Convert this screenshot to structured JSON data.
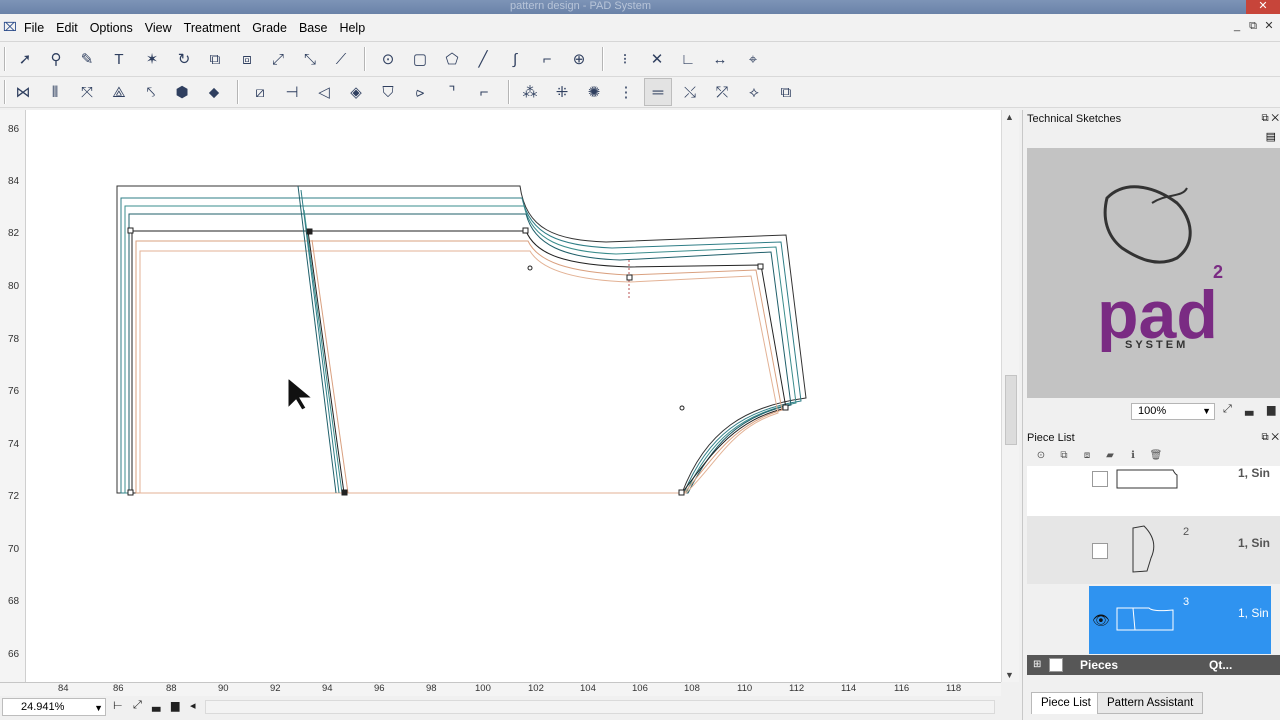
{
  "window": {
    "title": "pattern design - PAD System",
    "close_label": "✕"
  },
  "menu": [
    "File",
    "Edit",
    "Options",
    "View",
    "Treatment",
    "Grade",
    "Base",
    "Help"
  ],
  "window_controls": [
    "_",
    "⧉",
    "✕"
  ],
  "toolbar1_icons": [
    "select-arrow-icon",
    "zoom-icon",
    "measure-ruler-icon",
    "text-tool-icon",
    "point-tool-icon",
    "rotate-icon",
    "copy-piece-icon",
    "move-piece-icon",
    "scale-icon",
    "split-icon",
    "mirror-icon",
    "circle-tool-icon",
    "rectangle-tool-icon",
    "polygon-tool-icon",
    "line-tool-icon",
    "curve-tool-icon",
    "notch-tool-icon",
    "globe-tool-icon",
    "point-insert-icon",
    "point-delete-icon",
    "angle-tool-icon",
    "move-point-icon",
    "trace-icon"
  ],
  "toolbar2_icons": [
    "grade-rule-icon",
    "grade-copy-icon",
    "grade-scale-icon",
    "seam-icon",
    "dart-icon",
    "pleat-icon",
    "fold-icon",
    "box-tool-icon",
    "stretch-icon",
    "arrow-left-icon",
    "diamond-tool-icon",
    "shield-tool-icon",
    "corner-icon",
    "arc-tool-icon",
    "corner-curve-icon",
    "nest-icon",
    "piece-join-icon",
    "match-icon",
    "grade-nest-icon",
    "parallel-icon",
    "measure-icon",
    "grade-alt-icon",
    "gradient-icon",
    "layer-icon"
  ],
  "vruler_labels": [
    "86",
    "84",
    "82",
    "80",
    "78",
    "76",
    "74",
    "72",
    "70",
    "68",
    "66"
  ],
  "hruler_labels": [
    "84",
    "86",
    "88",
    "90",
    "92",
    "94",
    "96",
    "98",
    "100",
    "102",
    "104",
    "106",
    "108",
    "110",
    "112",
    "114",
    "116",
    "118"
  ],
  "status": {
    "zoom": "24.941%"
  },
  "panels": {
    "sketches": {
      "title": "Technical Sketches",
      "zoom": "100%",
      "logo_text": "pad",
      "logo_sup": "2",
      "logo_sub": "SYSTEM"
    },
    "piece_list": {
      "title": "Piece List",
      "rows": [
        {
          "num": "",
          "size": "1, Sin"
        },
        {
          "num": "2",
          "size": "1, Sin"
        },
        {
          "num": "3",
          "size": "1, Sin"
        }
      ],
      "footer_label": "Pieces",
      "footer_qty": "Qt..."
    }
  },
  "tabs": [
    "Piece List",
    "Pattern Assistant"
  ]
}
